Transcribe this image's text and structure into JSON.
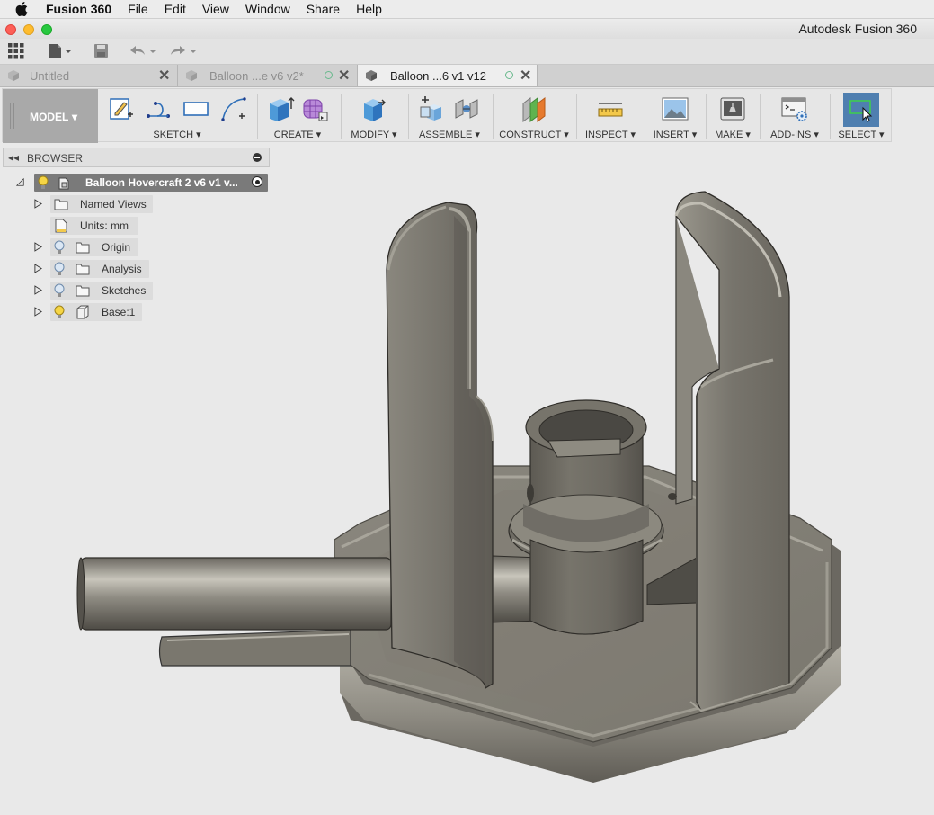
{
  "menubar": {
    "app_name": "Fusion 360",
    "items": [
      "File",
      "Edit",
      "View",
      "Window",
      "Share",
      "Help"
    ]
  },
  "window": {
    "title": "Autodesk Fusion 360"
  },
  "tabs": [
    {
      "label": "Untitled",
      "active": false
    },
    {
      "label": "Balloon ...e v6 v2*",
      "active": false
    },
    {
      "label": "Balloon ...6 v1 v12",
      "active": true
    }
  ],
  "toolbar": {
    "workspace_label": "MODEL",
    "groups": [
      "SKETCH",
      "CREATE",
      "MODIFY",
      "ASSEMBLE",
      "CONSTRUCT",
      "INSPECT",
      "INSERT",
      "MAKE",
      "ADD-INS",
      "SELECT"
    ]
  },
  "browser": {
    "title": "BROWSER",
    "root": "Balloon Hovercraft 2 v6 v1 v...",
    "nodes": [
      {
        "label": "Named Views",
        "icon": "folder-icon"
      },
      {
        "label": "Units: mm",
        "icon": "document-icon"
      },
      {
        "label": "Origin",
        "icon": "folder-icon"
      },
      {
        "label": "Analysis",
        "icon": "folder-icon"
      },
      {
        "label": "Sketches",
        "icon": "folder-icon"
      },
      {
        "label": "Base:1",
        "icon": "body-icon"
      }
    ]
  },
  "colors": {
    "select_active": "#4f7fb0",
    "model_gray": "#7c7a72",
    "workspace_bg": "#a9a9a9"
  }
}
